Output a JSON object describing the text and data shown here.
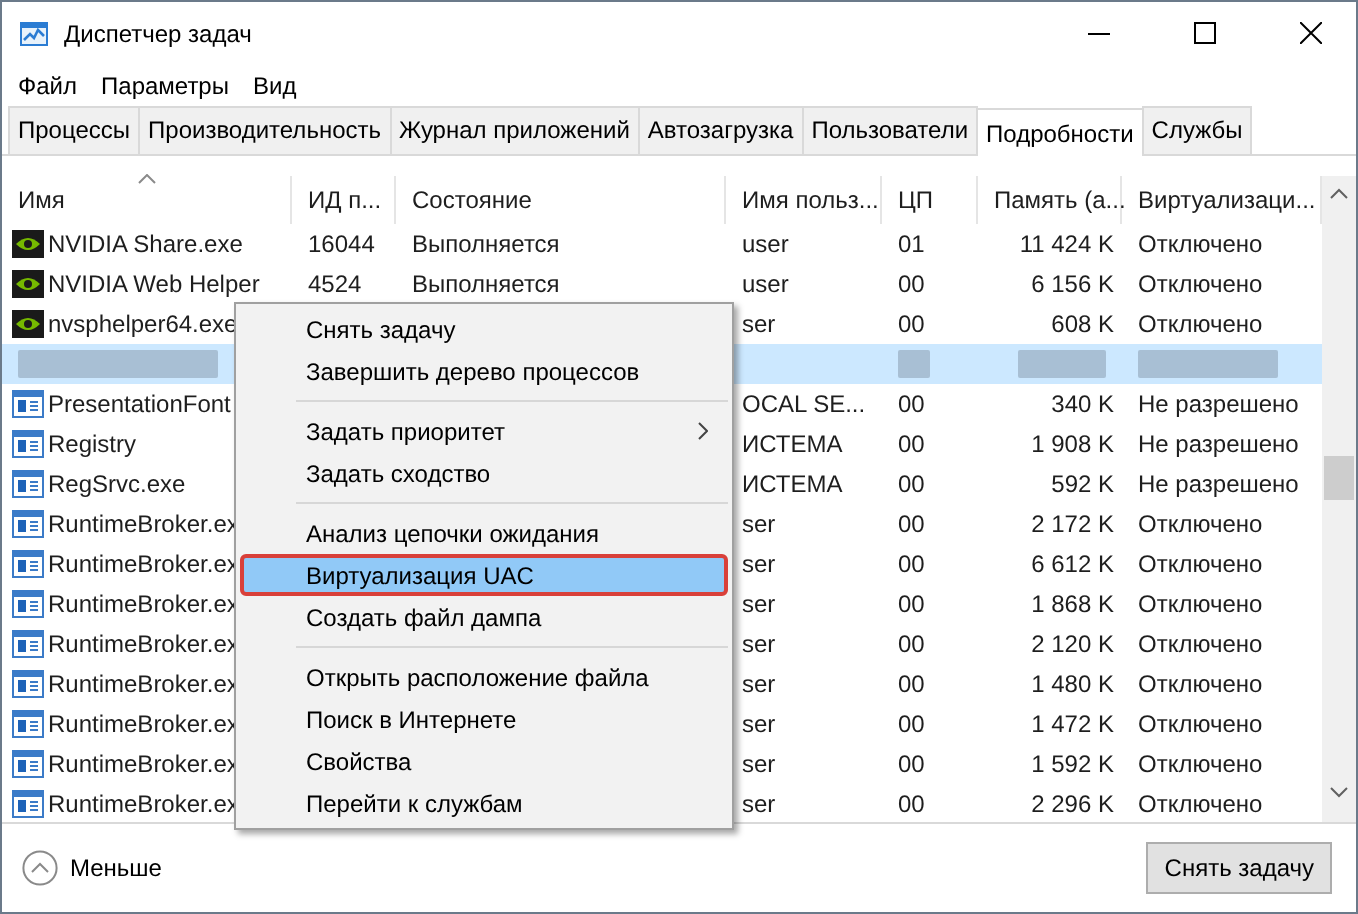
{
  "window": {
    "title": "Диспетчер задач"
  },
  "menu_bar": [
    "Файл",
    "Параметры",
    "Вид"
  ],
  "tabs": [
    {
      "label": "Процессы",
      "selected": false
    },
    {
      "label": "Производительность",
      "selected": false
    },
    {
      "label": "Журнал приложений",
      "selected": false
    },
    {
      "label": "Автозагрузка",
      "selected": false
    },
    {
      "label": "Пользователи",
      "selected": false
    },
    {
      "label": "Подробности",
      "selected": true
    },
    {
      "label": "Службы",
      "selected": false
    }
  ],
  "table": {
    "columns": [
      {
        "label": "Имя",
        "sorted": true
      },
      {
        "label": "ИД п...",
        "sorted": false
      },
      {
        "label": "Состояние",
        "sorted": false
      },
      {
        "label": "Имя польз...",
        "sorted": false
      },
      {
        "label": "ЦП",
        "sorted": false
      },
      {
        "label": "Память (а...",
        "sorted": false
      },
      {
        "label": "Виртуализаци...",
        "sorted": false
      }
    ],
    "rows": [
      {
        "kind": "nvidia",
        "selected": false,
        "name": "NVIDIA Share.exe",
        "pid": "16044",
        "status": "Выполняется",
        "user": "user",
        "cpu": "01",
        "memory": "11 424 K",
        "virtualization": "Отключено"
      },
      {
        "kind": "nvidia",
        "selected": false,
        "name": "NVIDIA Web Helper",
        "pid": "4524",
        "status": "Выполняется",
        "user": "user",
        "cpu": "00",
        "memory": "6 156 K",
        "virtualization": "Отключено"
      },
      {
        "kind": "nvidia",
        "selected": false,
        "name": "nvsphelper64.exe",
        "user": "ser",
        "cpu": "00",
        "memory": "608 K",
        "virtualization": "Отключено"
      },
      {
        "kind": "blurred",
        "selected": true
      },
      {
        "kind": "app",
        "selected": false,
        "name": "PresentationFont",
        "user": "OCAL SE...",
        "cpu": "00",
        "memory": "340 K",
        "virtualization": "Не разрешено"
      },
      {
        "kind": "app",
        "selected": false,
        "name": "Registry",
        "user": "ИСТЕМА",
        "cpu": "00",
        "memory": "1 908 K",
        "virtualization": "Не разрешено"
      },
      {
        "kind": "app",
        "selected": false,
        "name": "RegSrvc.exe",
        "user": "ИСТЕМА",
        "cpu": "00",
        "memory": "592 K",
        "virtualization": "Не разрешено"
      },
      {
        "kind": "app",
        "selected": false,
        "name": "RuntimeBroker.ex",
        "user": "ser",
        "cpu": "00",
        "memory": "2 172 K",
        "virtualization": "Отключено"
      },
      {
        "kind": "app",
        "selected": false,
        "name": "RuntimeBroker.ex",
        "user": "ser",
        "cpu": "00",
        "memory": "6 612 K",
        "virtualization": "Отключено"
      },
      {
        "kind": "app",
        "selected": false,
        "name": "RuntimeBroker.ex",
        "user": "ser",
        "cpu": "00",
        "memory": "1 868 K",
        "virtualization": "Отключено"
      },
      {
        "kind": "app",
        "selected": false,
        "name": "RuntimeBroker.ex",
        "user": "ser",
        "cpu": "00",
        "memory": "2 120 K",
        "virtualization": "Отключено"
      },
      {
        "kind": "app",
        "selected": false,
        "name": "RuntimeBroker.ex",
        "user": "ser",
        "cpu": "00",
        "memory": "1 480 K",
        "virtualization": "Отключено"
      },
      {
        "kind": "app",
        "selected": false,
        "name": "RuntimeBroker.ex",
        "user": "ser",
        "cpu": "00",
        "memory": "1 472 K",
        "virtualization": "Отключено"
      },
      {
        "kind": "app",
        "selected": false,
        "name": "RuntimeBroker.ex",
        "user": "ser",
        "cpu": "00",
        "memory": "1 592 K",
        "virtualization": "Отключено"
      },
      {
        "kind": "app",
        "selected": false,
        "name": "RuntimeBroker.ex",
        "user": "ser",
        "cpu": "00",
        "memory": "2 296 K",
        "virtualization": "Отключено"
      }
    ]
  },
  "context_menu": {
    "items": [
      {
        "kind": "item",
        "label": "Снять задачу",
        "selected": false
      },
      {
        "kind": "item",
        "label": "Завершить дерево процессов",
        "selected": false
      },
      {
        "kind": "separator"
      },
      {
        "kind": "submenu",
        "label": "Задать приоритет",
        "selected": false
      },
      {
        "kind": "item",
        "label": "Задать сходство",
        "selected": false
      },
      {
        "kind": "separator"
      },
      {
        "kind": "item",
        "label": "Анализ цепочки ожидания",
        "selected": false
      },
      {
        "kind": "item",
        "label": "Виртуализация UAC",
        "selected": true
      },
      {
        "kind": "item",
        "label": "Создать файл дампа",
        "selected": false
      },
      {
        "kind": "separator"
      },
      {
        "kind": "item",
        "label": "Открыть расположение файла",
        "selected": false
      },
      {
        "kind": "item",
        "label": "Поиск в Интернете",
        "selected": false
      },
      {
        "kind": "item",
        "label": "Свойства",
        "selected": false
      },
      {
        "kind": "item",
        "label": "Перейти к службам",
        "selected": false
      }
    ]
  },
  "footer": {
    "toggle": "Меньше",
    "button": "Снять задачу"
  }
}
